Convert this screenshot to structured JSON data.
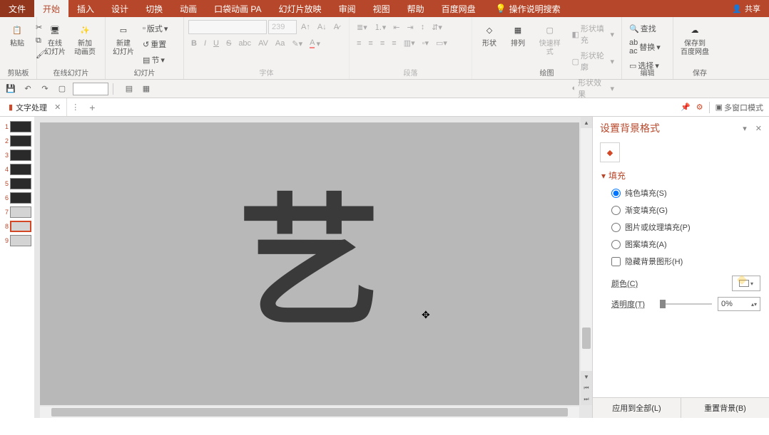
{
  "titlebar": {
    "tabs": {
      "file": "文件",
      "home": "开始",
      "insert": "插入",
      "design": "设计",
      "transition": "切换",
      "animation": "动画",
      "pocket": "口袋动画 PA",
      "slideshow": "幻灯片放映",
      "review": "审阅",
      "view": "视图",
      "help": "帮助",
      "baidu": "百度网盘",
      "tellme": "操作说明搜索"
    },
    "share": "共享"
  },
  "ribbon": {
    "clipboard": {
      "label": "剪贴板",
      "paste": "粘贴"
    },
    "onlineslide": {
      "label": "在线幻灯片",
      "online": "在线\n幻灯片",
      "newpage": "新加\n动画页"
    },
    "slides": {
      "label": "幻灯片",
      "newslide": "新建\n幻灯片",
      "layout": "版式",
      "reset": "重置",
      "section": "节"
    },
    "font": {
      "label": "字体",
      "size": "239"
    },
    "paragraph": {
      "label": "段落"
    },
    "drawing": {
      "label": "绘图",
      "shapes": "形状",
      "arrange": "排列",
      "quick": "快速样式",
      "fill": "形状填充",
      "outline": "形状轮廓",
      "effects": "形状效果"
    },
    "editing": {
      "label": "编辑",
      "find": "查找",
      "replace": "替换",
      "select": "选择"
    },
    "save": {
      "label": "保存",
      "saveto": "保存到\n百度网盘"
    }
  },
  "doctab": {
    "name": "文字处理"
  },
  "multiwindow": "多窗口模式",
  "canvas_glyph": "艺",
  "panel": {
    "title": "设置背景格式",
    "section_fill": "填充",
    "opts": {
      "solid": "纯色填充(S)",
      "gradient": "渐变填充(G)",
      "picture": "图片或纹理填充(P)",
      "pattern": "图案填充(A)",
      "hide": "隐藏背景图形(H)"
    },
    "color": "颜色(C)",
    "transparency": "透明度(T)",
    "transparency_val": "0%",
    "apply_all": "应用到全部(L)",
    "reset_bg": "重置背景(B)"
  }
}
